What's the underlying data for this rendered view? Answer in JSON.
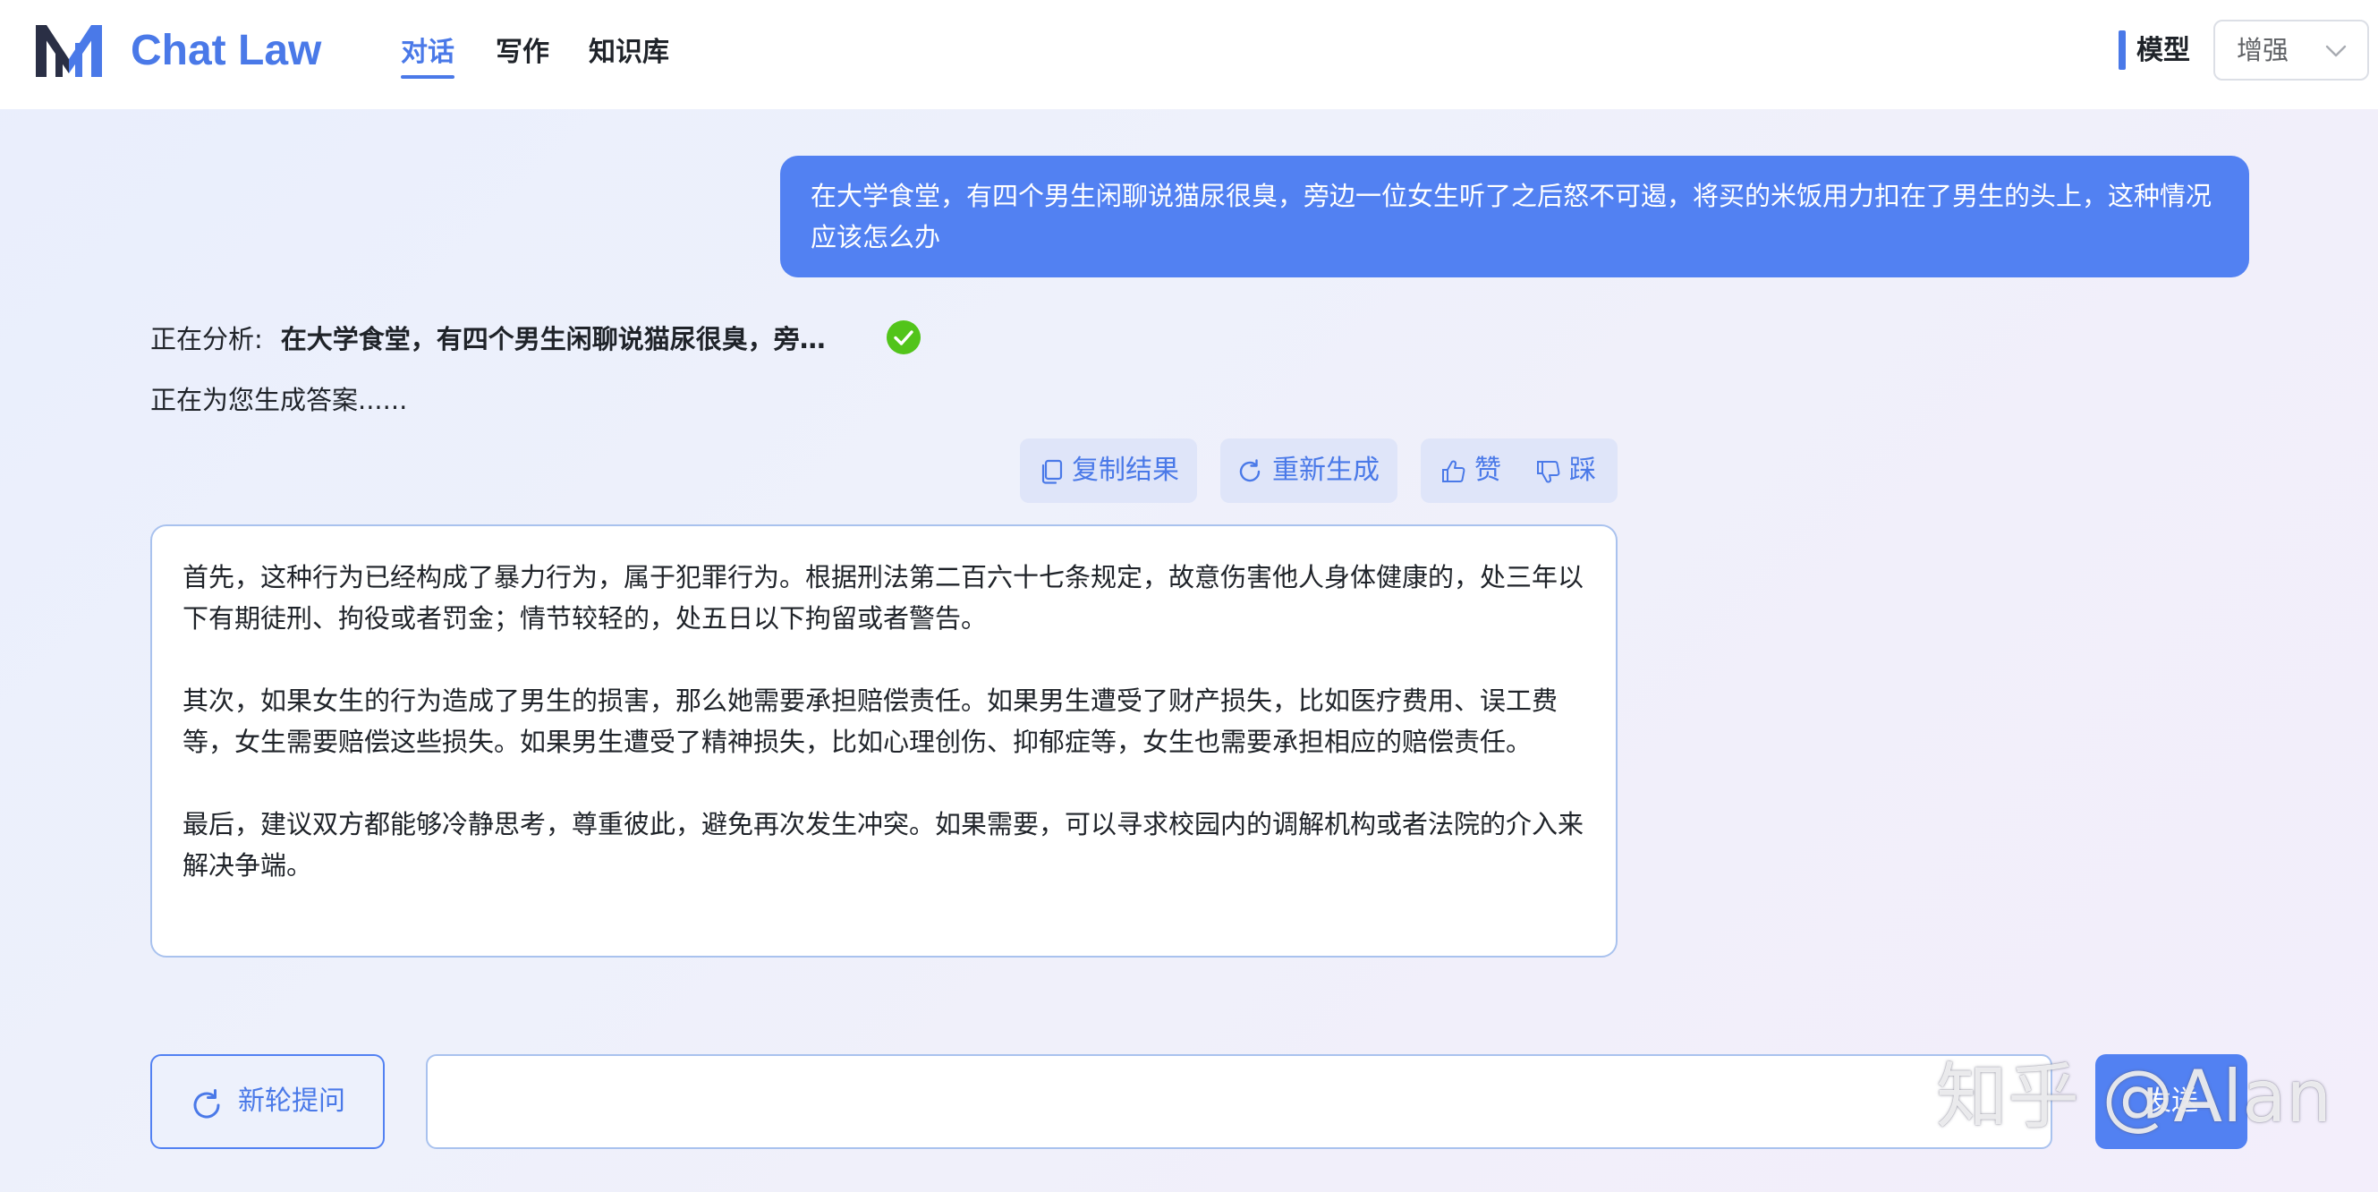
{
  "app": {
    "title": "Chat Law"
  },
  "nav": {
    "tabs": [
      {
        "label": "对话",
        "active": true
      },
      {
        "label": "写作",
        "active": false
      },
      {
        "label": "知识库",
        "active": false
      }
    ]
  },
  "model": {
    "label": "模型",
    "selected": "增强"
  },
  "conversation": {
    "user_message": "在大学食堂，有四个男生闲聊说猫尿很臭，旁边一位女生听了之后怒不可遏，将买的米饭用力扣在了男生的头上，这种情况应该怎么办",
    "analyzing_prefix": "正在分析:",
    "analyzing_query": "在大学食堂，有四个男生闲聊说猫尿很臭，旁…",
    "generating_status": "正在为您生成答案......",
    "actions": {
      "copy": "复制结果",
      "regenerate": "重新生成",
      "like": "赞",
      "dislike": "踩"
    },
    "answer_paragraphs": [
      "首先，这种行为已经构成了暴力行为，属于犯罪行为。根据刑法第二百六十七条规定，故意伤害他人身体健康的，处三年以下有期徒刑、拘役或者罚金；情节较轻的，处五日以下拘留或者警告。",
      "其次，如果女生的行为造成了男生的损害，那么她需要承担赔偿责任。如果男生遭受了财产损失，比如医疗费用、误工费等，女生需要赔偿这些损失。如果男生遭受了精神损失，比如心理创伤、抑郁症等，女生也需要承担相应的赔偿责任。",
      "最后，建议双方都能够冷静思考，尊重彼此，避免再次发生冲突。如果需要，可以寻求校园内的调解机构或者法院的介入来解决争端。"
    ]
  },
  "input_bar": {
    "new_round_label": "新轮提问",
    "input_value": "",
    "send_label": "发送"
  },
  "watermark": "知乎 @Alan",
  "colors": {
    "accent": "#4a79e8",
    "user_bubble": "#5281f2",
    "success": "#52c41a",
    "action_bg": "#dfe5f9",
    "card_border": "#a9c2ee"
  },
  "icons": {
    "logo": "chat-law-logo",
    "check": "check-circle-icon",
    "copy": "copy-icon",
    "regenerate": "refresh-icon",
    "like": "thumbs-up-icon",
    "dislike": "thumbs-down-icon",
    "new_round": "refresh-icon",
    "select": "chevron-down-icon"
  }
}
